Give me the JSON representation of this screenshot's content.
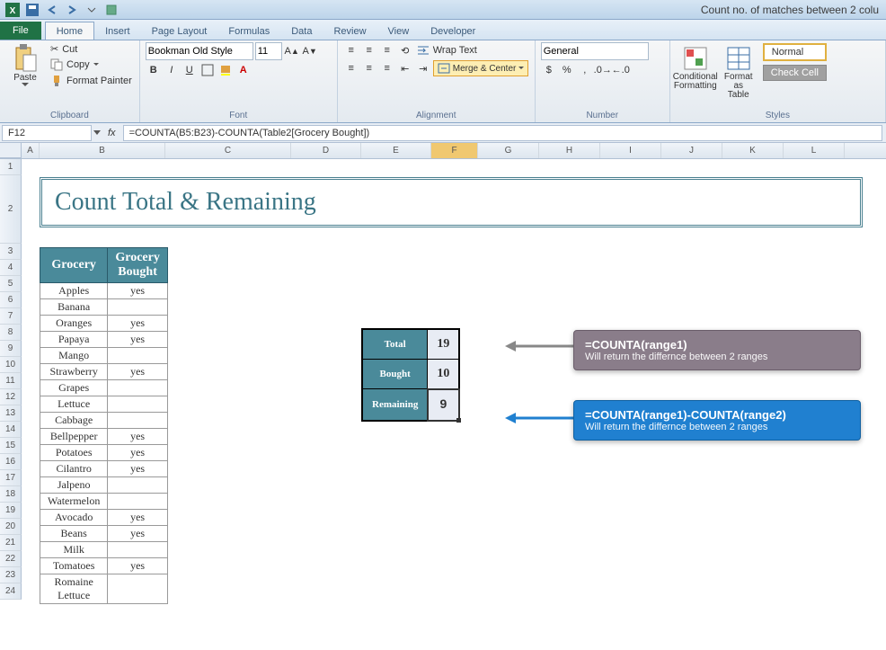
{
  "window": {
    "title": "Count no. of matches between 2 colu"
  },
  "qat": {
    "save": "save-icon",
    "undo": "undo-icon",
    "redo": "redo-icon"
  },
  "tabs": [
    "File",
    "Home",
    "Insert",
    "Page Layout",
    "Formulas",
    "Data",
    "Review",
    "View",
    "Developer"
  ],
  "active_tab": "Home",
  "ribbon": {
    "clipboard": {
      "label": "Clipboard",
      "paste": "Paste",
      "cut": "Cut",
      "copy": "Copy",
      "painter": "Format Painter"
    },
    "font": {
      "label": "Font",
      "name": "Bookman Old Style",
      "size": "11"
    },
    "alignment": {
      "label": "Alignment",
      "wrap": "Wrap Text",
      "merge": "Merge & Center"
    },
    "number": {
      "label": "Number",
      "format": "General"
    },
    "styles": {
      "label": "Styles",
      "conditional": "Conditional\nFormatting",
      "table": "Format\nas Table",
      "normal": "Normal",
      "check": "Check Cell"
    }
  },
  "fbar": {
    "cell": "F12",
    "formula": "=COUNTA(B5:B23)-COUNTA(Table2[Grocery Bought])"
  },
  "cols": [
    "A",
    "B",
    "C",
    "D",
    "E",
    "F",
    "G",
    "H",
    "I",
    "J",
    "K",
    "L"
  ],
  "rows": [
    "1",
    "2",
    "3",
    "4",
    "5",
    "6",
    "7",
    "8",
    "9",
    "10",
    "11",
    "12",
    "13",
    "14",
    "15",
    "16",
    "17",
    "18",
    "19",
    "20",
    "21",
    "22",
    "23",
    "24"
  ],
  "selected_col": "F",
  "sheet": {
    "title": "Count Total & Remaining",
    "headers": {
      "grocery": "Grocery",
      "bought": "Grocery Bought"
    },
    "items": [
      {
        "name": "Apples",
        "bought": "yes"
      },
      {
        "name": "Banana",
        "bought": ""
      },
      {
        "name": "Oranges",
        "bought": "yes"
      },
      {
        "name": "Papaya",
        "bought": "yes"
      },
      {
        "name": "Mango",
        "bought": ""
      },
      {
        "name": "Strawberry",
        "bought": "yes"
      },
      {
        "name": "Grapes",
        "bought": ""
      },
      {
        "name": "Lettuce",
        "bought": ""
      },
      {
        "name": "Cabbage",
        "bought": ""
      },
      {
        "name": "Bellpepper",
        "bought": "yes"
      },
      {
        "name": "Potatoes",
        "bought": "yes"
      },
      {
        "name": "Cilantro",
        "bought": "yes"
      },
      {
        "name": "Jalpeno",
        "bought": ""
      },
      {
        "name": "Watermelon",
        "bought": ""
      },
      {
        "name": "Avocado",
        "bought": "yes"
      },
      {
        "name": "Beans",
        "bought": "yes"
      },
      {
        "name": "Milk",
        "bought": ""
      },
      {
        "name": "Tomatoes",
        "bought": "yes"
      },
      {
        "name": "Romaine Lettuce",
        "bought": ""
      }
    ],
    "summary": {
      "total_label": "Total",
      "total_val": "19",
      "bought_label": "Bought",
      "bought_val": "10",
      "remaining_label": "Remaining",
      "remaining_val": "9"
    },
    "callouts": {
      "c1_formula": "=COUNTA(range1)",
      "c1_desc": "Will return the differnce between 2 ranges",
      "c2_formula": "=COUNTA(range1)-COUNTA(range2)",
      "c2_desc": "Will return the differnce between 2 ranges"
    }
  }
}
